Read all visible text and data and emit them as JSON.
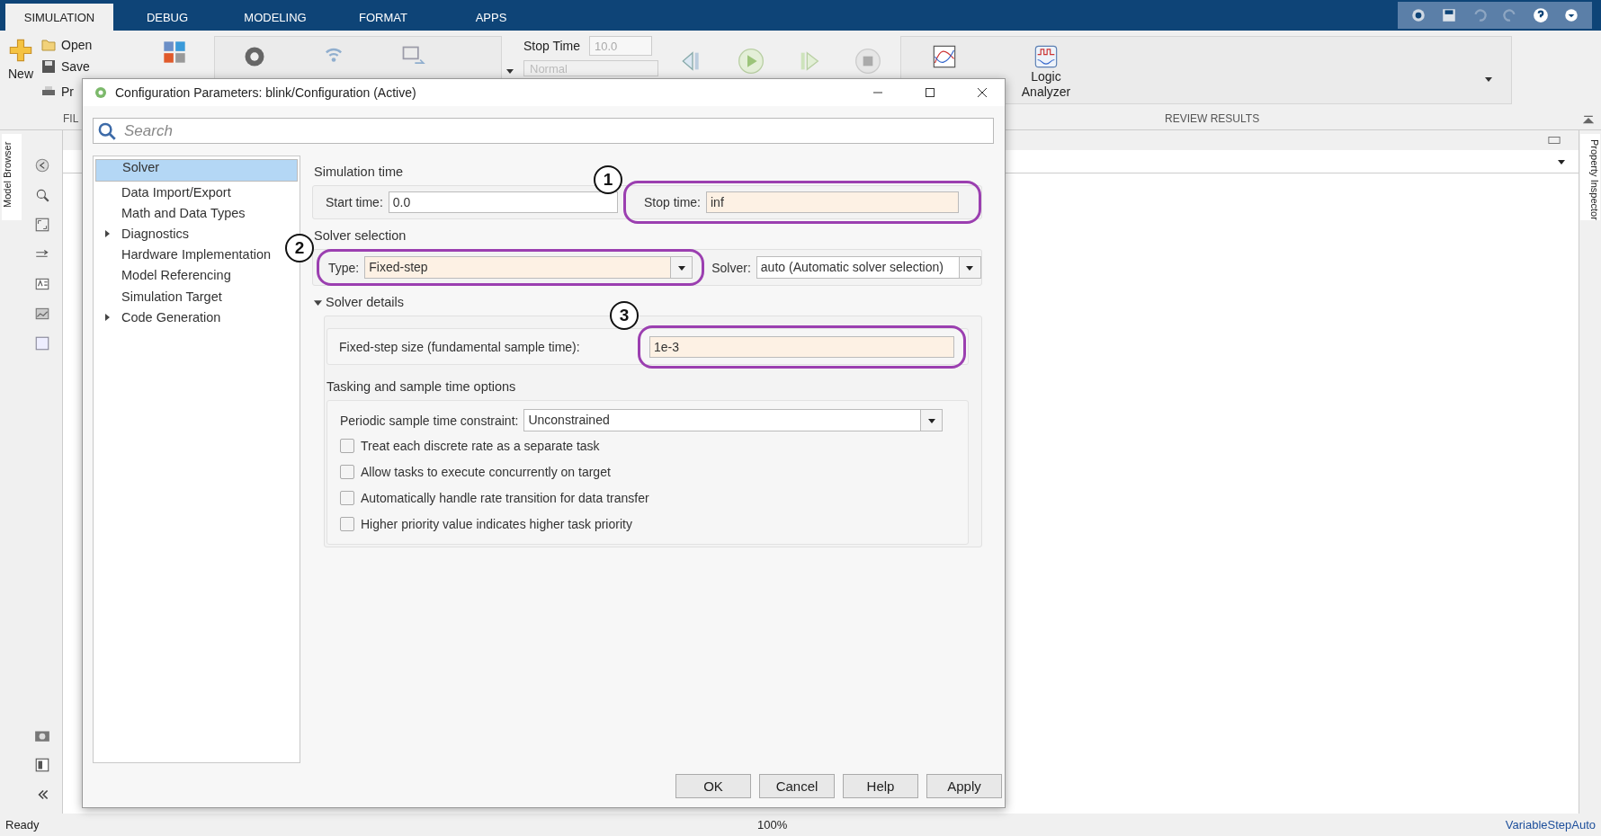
{
  "tabs": [
    {
      "label": "SIMULATION",
      "selected": true
    },
    {
      "label": "DEBUG",
      "selected": false
    },
    {
      "label": "MODELING",
      "selected": false
    },
    {
      "label": "FORMAT",
      "selected": false
    },
    {
      "label": "APPS",
      "selected": false
    }
  ],
  "ribbon": {
    "new_label": "New",
    "open_label": "Open",
    "save_label": "Save",
    "print_label": "Pr",
    "file_section": "FIL",
    "stop_time_label": "Stop Time",
    "stop_time_value": "10.0",
    "mode_value": "Normal",
    "logic_analyzer": "Logic Analyzer",
    "review_section": "REVIEW RESULTS"
  },
  "side_tabs": {
    "left": "Model Browser",
    "right": "Property Inspector"
  },
  "dialog": {
    "title": "Configuration Parameters: blink/Configuration (Active)",
    "search": {
      "placeholder": "Search"
    },
    "tree": [
      {
        "label": "Solver",
        "kind": "leaf",
        "selected": true
      },
      {
        "label": "Data Import/Export",
        "kind": "leaf",
        "selected": false
      },
      {
        "label": "Math and Data Types",
        "kind": "leaf",
        "selected": false
      },
      {
        "label": "Diagnostics",
        "kind": "group",
        "expanded": false,
        "selected": false
      },
      {
        "label": "Hardware Implementation",
        "kind": "leaf",
        "selected": false
      },
      {
        "label": "Model Referencing",
        "kind": "leaf",
        "selected": false
      },
      {
        "label": "Simulation Target",
        "kind": "leaf",
        "selected": false
      },
      {
        "label": "Code Generation",
        "kind": "group",
        "expanded": false,
        "selected": false
      }
    ],
    "simulation_time": {
      "heading": "Simulation time",
      "start": {
        "label": "Start time:",
        "value": "0.0",
        "highlighted": false
      },
      "stop": {
        "label": "Stop time:",
        "value": "inf",
        "highlighted": true,
        "marker": "1"
      }
    },
    "solver_selection": {
      "heading": "Solver selection",
      "type": {
        "label": "Type:",
        "value": "Fixed-step",
        "highlighted": true,
        "marker": "2"
      },
      "solver": {
        "label": "Solver:",
        "value": "auto (Automatic solver selection)",
        "highlighted": false
      }
    },
    "solver_details": {
      "heading": "Solver details",
      "expanded": true,
      "step_size": {
        "label": "Fixed-step size (fundamental sample time):",
        "value": "1e-3",
        "highlighted": true,
        "marker": "3"
      },
      "tasking_heading": "Tasking and sample time options",
      "constraint": {
        "label": "Periodic sample time constraint:",
        "value": "Unconstrained"
      },
      "options": [
        {
          "label": "Treat each discrete rate as a separate task",
          "checked": false
        },
        {
          "label": "Allow tasks to execute concurrently on target",
          "checked": false
        },
        {
          "label": "Automatically handle rate transition for data transfer",
          "checked": false
        },
        {
          "label": "Higher priority value indicates higher task priority",
          "checked": false
        }
      ]
    },
    "buttons": [
      "OK",
      "Cancel",
      "Help",
      "Apply"
    ]
  },
  "status_bar": {
    "left": "Ready",
    "center": "100%",
    "right": "VariableStepAuto"
  }
}
